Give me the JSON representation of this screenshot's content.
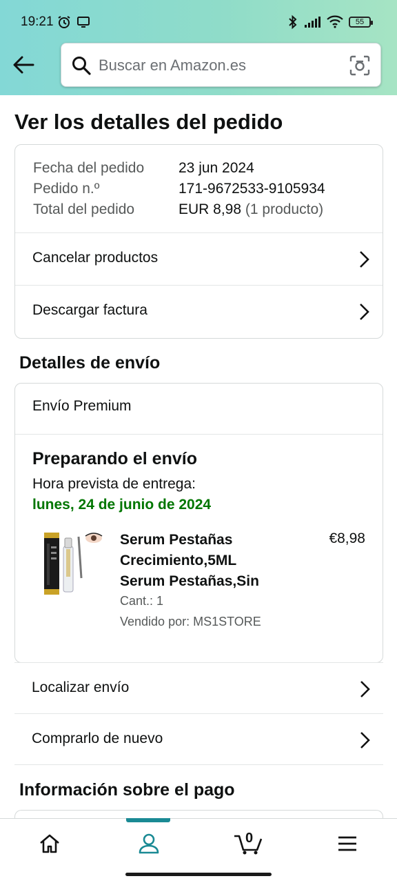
{
  "status_bar": {
    "time": "19:21",
    "battery": "55"
  },
  "search": {
    "placeholder": "Buscar en Amazon.es"
  },
  "page_title": "Ver los detalles del pedido",
  "order_summary": {
    "rows": [
      {
        "label": "Fecha del pedido",
        "value": "23 jun 2024",
        "extra": ""
      },
      {
        "label": "Pedido n.º",
        "value": "171-9672533-9105934",
        "extra": ""
      },
      {
        "label": "Total del pedido",
        "value": "EUR 8,98",
        "extra": "(1 producto)"
      }
    ],
    "actions": [
      {
        "label": "Cancelar productos"
      },
      {
        "label": "Descargar factura"
      }
    ]
  },
  "shipping": {
    "section_title": "Detalles de envío",
    "type": "Envío Premium",
    "status": "Preparando el envío",
    "eta_label": "Hora prevista de entrega:",
    "eta_date": "lunes, 24 de junio de 2024",
    "product": {
      "title_lines": [
        "Serum Pestañas",
        "Crecimiento,5ML",
        "Serum Pestañas,Sin"
      ],
      "price": "€8,98",
      "quantity": "Cant.: 1",
      "seller": "Vendido por: MS1STORE"
    },
    "actions": [
      {
        "label": "Localizar envío"
      },
      {
        "label": "Comprarlo de nuevo"
      }
    ]
  },
  "payment": {
    "section_title": "Información sobre el pago"
  },
  "bottom_nav": {
    "items": [
      "home-icon",
      "account-icon",
      "cart-icon",
      "menu-icon"
    ],
    "active": "account-icon",
    "cart_count": "0"
  },
  "colors": {
    "header_start": "#83d8d6",
    "header_end": "#a6e4c4",
    "eta_green": "#007600",
    "nav_active": "#1a8a94"
  }
}
